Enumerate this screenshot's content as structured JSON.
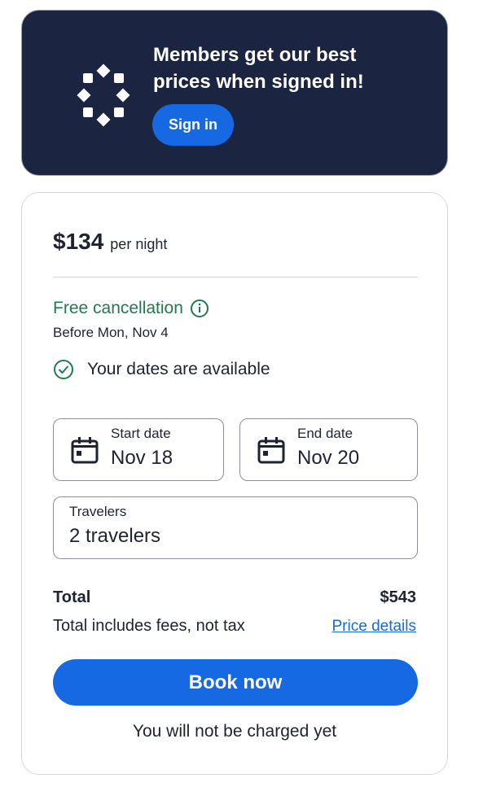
{
  "promo": {
    "message": "Members get our best prices when signed in!",
    "signin_label": "Sign in",
    "icon": "sparkle-ring-icon"
  },
  "booking": {
    "price": "$134",
    "price_unit": "per night",
    "cancellation": {
      "title": "Free cancellation",
      "subtitle": "Before Mon, Nov 4",
      "icon": "info-icon"
    },
    "availability": {
      "text": "Your dates are available",
      "icon": "check-circle-icon"
    },
    "start_date": {
      "label": "Start date",
      "value": "Nov 18",
      "icon": "calendar-icon"
    },
    "end_date": {
      "label": "End date",
      "value": "Nov 20",
      "icon": "calendar-icon"
    },
    "travelers": {
      "label": "Travelers",
      "value": "2 travelers"
    },
    "total_label": "Total",
    "total_value": "$543",
    "fees_text": "Total includes fees, not tax",
    "price_details_label": "Price details",
    "book_label": "Book now",
    "note": "You will not be charged yet"
  },
  "colors": {
    "promo_bg": "#1b2440",
    "accent": "#1668e3",
    "success": "#227950",
    "text": "#1f2330"
  }
}
